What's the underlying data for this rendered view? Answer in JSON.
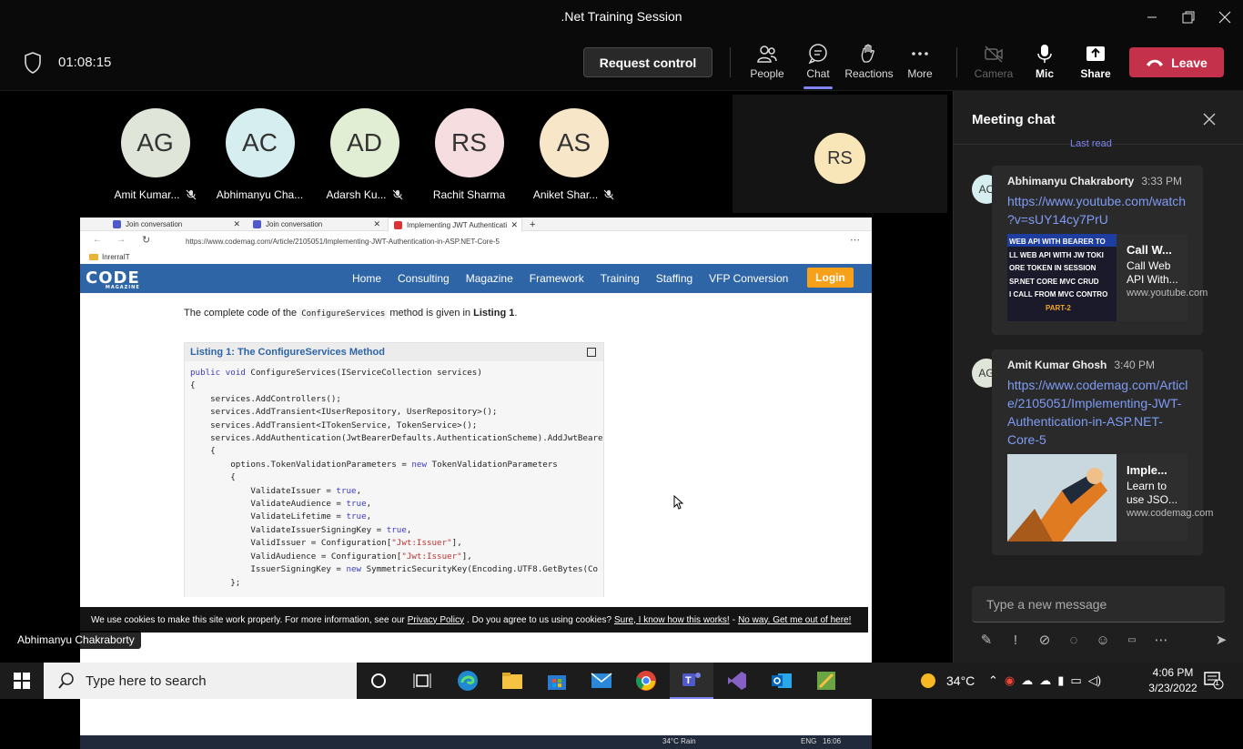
{
  "window": {
    "title": ".Net Training Session"
  },
  "toolbar": {
    "timer": "01:08:15",
    "request_control": "Request control",
    "people": "People",
    "chat": "Chat",
    "reactions": "Reactions",
    "more": "More",
    "camera": "Camera",
    "mic": "Mic",
    "share": "Share",
    "leave": "Leave",
    "accent": "#7f85f5",
    "leave_color": "#c4314b"
  },
  "participants": [
    {
      "initials": "AG",
      "name": "Amit Kumar...",
      "muted": true,
      "color": "#dfe5d9"
    },
    {
      "initials": "AC",
      "name": "Abhimanyu Cha...",
      "muted": false,
      "color": "#d6eef0"
    },
    {
      "initials": "AD",
      "name": "Adarsh Ku...",
      "muted": true,
      "color": "#e1eed3"
    },
    {
      "initials": "RS",
      "name": "Rachit Sharma",
      "muted": false,
      "color": "#f6dde0"
    },
    {
      "initials": "AS",
      "name": "Aniket Shar...",
      "muted": true,
      "color": "#f8e6c8"
    }
  ],
  "self_tile": {
    "initials": "RS"
  },
  "presenter_label": "Abhimanyu Chakraborty",
  "shared_screen": {
    "tabs": [
      "Join conversation",
      "Join conversation",
      "Implementing JWT Authenticati"
    ],
    "address": "https://www.codemag.com/Article/2105051/Implementing-JWT-Authentication-in-ASP.NET-Core-5",
    "favorite_folder": "InrerraIT",
    "site_logo": "CODE",
    "site_logo_sub": "MAGAZINE",
    "nav": [
      "Home",
      "Consulting",
      "Magazine",
      "Framework",
      "Training",
      "Staffing",
      "VFP Conversion"
    ],
    "login": "Login",
    "intro_before": "The complete code of the",
    "intro_code": "ConfigureServices",
    "intro_middle": "method is given in",
    "intro_bold": "Listing 1",
    "intro_after": ".",
    "listing_title": "Listing 1: The ConfigureServices Method",
    "code": [
      "public void ConfigureServices(IServiceCollection services)",
      "{",
      "    services.AddControllers();",
      "    services.AddTransient<IUserRepository, UserRepository>();",
      "    services.AddTransient<ITokenService, TokenService>();",
      "    services.AddAuthentication(JwtBearerDefaults.AuthenticationScheme).AddJwtBeare",
      "    {",
      "        options.TokenValidationParameters = new TokenValidationParameters",
      "        {",
      "            ValidateIssuer = true,",
      "            ValidateAudience = true,",
      "            ValidateLifetime = true,",
      "            ValidateIssuerSigningKey = true,",
      "            ValidIssuer = Configuration[\"Jwt:Issuer\"],",
      "            ValidAudience = Configuration[\"Jwt:Issuer\"],",
      "            IssuerSigningKey = new SymmetricSecurityKey(Encoding.UTF8.GetBytes(Co",
      "        };"
    ],
    "cookie_text": "We use cookies to make this site work properly. For more information, see our",
    "cookie_policy": "Privacy Policy",
    "cookie_question": ". Do you agree to us using cookies?",
    "cookie_yes": "Sure, I know how this works!",
    "cookie_dash": " - ",
    "cookie_no": "No way. Get me out of here!",
    "inner_weather": "34°C  Rain",
    "inner_lang": "ENG",
    "inner_time": "16:06"
  },
  "chat": {
    "title": "Meeting chat",
    "last_read": "Last read",
    "messages": [
      {
        "initials": "AC",
        "sender": "Abhimanyu Chakraborty",
        "time": "3:33 PM",
        "link": "https://www.youtube.com/watch?v=sUY14cy7PrU",
        "preview_title": "Call W...",
        "preview_desc": "Call Web API With...",
        "preview_domain": "www.youtube.com",
        "thumb_lines": [
          "WEB API WITH BEARER TO",
          "LL WEB API WITH JW TOKI",
          "ORE TOKEN IN SESSION",
          "SP.NET CORE MVC CRUD",
          "I CALL FROM MVC CONTRO",
          "PART-2"
        ]
      },
      {
        "initials": "AG",
        "sender": "Amit Kumar Ghosh",
        "time": "3:40 PM",
        "link": "https://www.codemag.com/Article/2105051/Implementing-JWT-Authentication-in-ASP.NET-Core-5",
        "preview_title": "Imple...",
        "preview_desc": "Learn to use JSO...",
        "preview_domain": "www.codemag.com"
      }
    ],
    "compose_placeholder": "Type a new message"
  },
  "taskbar": {
    "search_placeholder": "Type here to search",
    "weather": "34°C",
    "time": "4:06 PM",
    "date": "3/23/2022",
    "notification_count": "1"
  }
}
